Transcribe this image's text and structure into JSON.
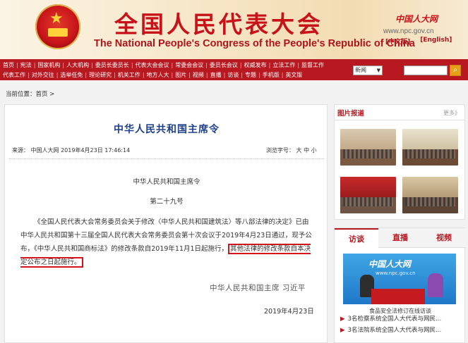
{
  "header": {
    "title_cn": "全国人民代表大会",
    "title_en": "The National People's Congress of the People's Republic of China",
    "brand_logo": "中国人大网",
    "brand_url": "www.npc.gov.cn",
    "lang_cn": "[中文版]",
    "lang_en": "[English]"
  },
  "nav": {
    "row1": [
      "首页",
      "宪法",
      "国家机构",
      "人大机构",
      "委员长委员长",
      "代表大会会议",
      "常委会会议",
      "委员长会议",
      "权威发布",
      "立法工作",
      "监督工作"
    ],
    "row2": [
      "代表工作",
      "对外交往",
      "选举任免",
      "理论研究",
      "机关工作",
      "地方人大",
      "图片",
      "视频",
      "直播",
      "访谈",
      "专题",
      "手机版",
      "英文版"
    ]
  },
  "search": {
    "select_value": "新闻",
    "button_icon": "search-icon"
  },
  "breadcrumb": "当前位置：首页 >",
  "article": {
    "title": "中华人民共和国主席令",
    "source": "来源：  中国人大网  2019年4月23日  17:46:14",
    "font_size_label": "浏览字号：  大  中  小",
    "heading": "中华人民共和国主席令",
    "number": "第二十九号",
    "body_part1": "《全国人民代表大会常务委员会关于修改〈中华人民共和国建筑法〉等八部法律的决定》已由中华人民共和国第十三届全国人民代表大会常务委员会第十次会议于2019年4月23日通过，现予公布，《中华人民共和国商标法》的修改条款自2019年11月1日起施行，",
    "body_highlight": "其他法律的修改条款自本决定公布之日起施行。",
    "signature": "中华人民共和国主席  习近平",
    "date": "2019年4月23日"
  },
  "sidebar": {
    "photo_title": "图片报道",
    "photo_more": "更多》",
    "tabs": [
      "访谈",
      "直播",
      "视频"
    ],
    "video_title": "中国人大网",
    "video_url": "www.npc.gov.cn",
    "video_caption": "食品安全法修订在线访谈",
    "news": [
      "3名检察系统全国人大代表与网民...",
      "3名法院系统全国人大代表与网民..."
    ]
  },
  "colors": {
    "brand_red": "#b81921",
    "title_blue": "#1e3f8c",
    "highlight_border": "#d4141c"
  }
}
